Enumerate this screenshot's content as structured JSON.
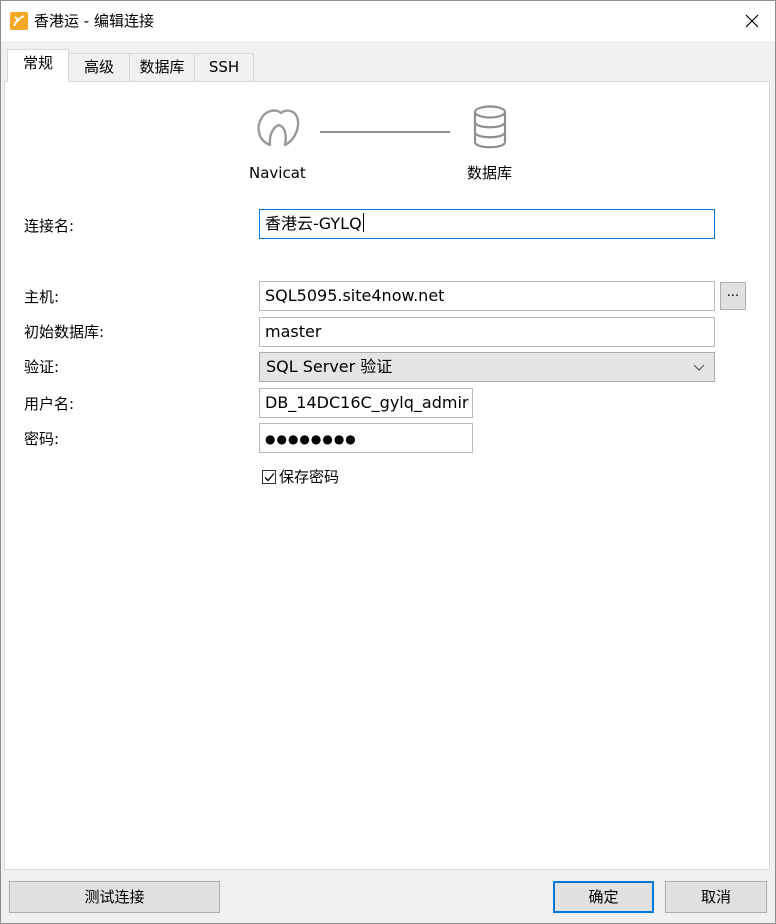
{
  "window": {
    "title": "香港运 - 编辑连接",
    "app_icon": "navicat-app-icon",
    "close_icon": "close-icon"
  },
  "tabs": [
    {
      "label": "常规",
      "active": true
    },
    {
      "label": "高级",
      "active": false
    },
    {
      "label": "数据库",
      "active": false
    },
    {
      "label": "SSH",
      "active": false
    }
  ],
  "diagram": {
    "left_label": "Navicat",
    "right_label": "数据库",
    "left_icon": "navicat-logo-icon",
    "right_icon": "database-icon"
  },
  "form": {
    "connection_name_label": "连接名:",
    "connection_name_value": "香港云-GYLQ",
    "host_label": "主机:",
    "host_value": "SQL5095.site4now.net",
    "browse_label": "...",
    "initial_db_label": "初始数据库:",
    "initial_db_value": "master",
    "auth_label": "验证:",
    "auth_value": "SQL Server 验证",
    "username_label": "用户名:",
    "username_value": "DB_14DC16C_gylq_admir",
    "password_label": "密码:",
    "password_value": "●●●●●●●●",
    "save_password_label": "保存密码",
    "save_password_checked": true
  },
  "buttons": {
    "test_connection": "测试连接",
    "ok": "确定",
    "cancel": "取消"
  },
  "colors": {
    "focus_border": "#0078d7",
    "app_icon": "#f5a623"
  }
}
